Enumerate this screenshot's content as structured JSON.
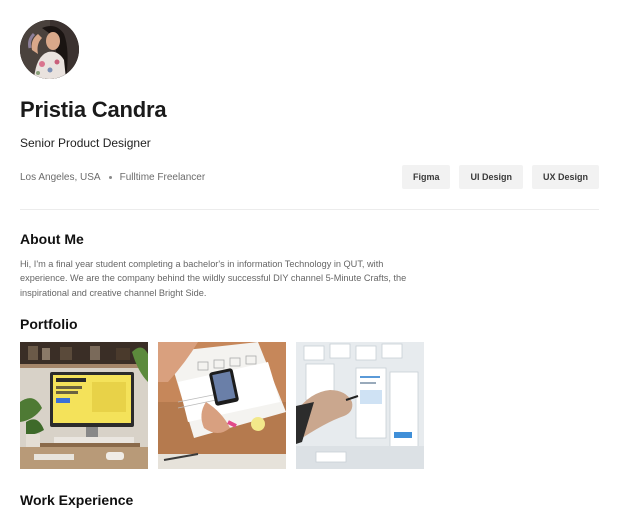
{
  "profile": {
    "name": "Pristia Candra",
    "role": "Senior Product Designer",
    "location": "Los Angeles, USA",
    "employment": "Fulltime Freelancer",
    "skills": [
      "Figma",
      "UI Design",
      "UX Design"
    ]
  },
  "about": {
    "title": "About Me",
    "text": "Hi, I'm a final year student completing a bachelor's in information Technology in QUT, with experience. We are the company behind the wildly successful DIY channel 5-Minute Crafts, the inspirational and creative channel Bright Side."
  },
  "portfolio": {
    "title": "Portfolio"
  },
  "work": {
    "title": "Work Experience"
  }
}
